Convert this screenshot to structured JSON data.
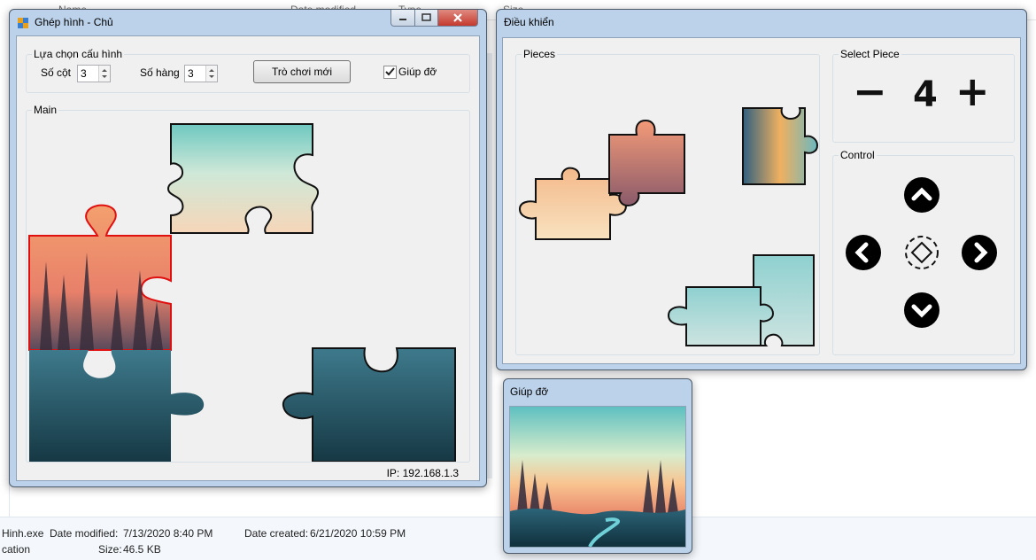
{
  "explorer": {
    "columns": [
      "Name",
      "Date modified",
      "Type",
      "Size"
    ],
    "details": {
      "file_name": "Hinh.exe",
      "date_modified_label": "Date modified:",
      "date_modified": "7/13/2020 8:40 PM",
      "date_created_label": "Date created:",
      "date_created": "6/21/2020 10:59 PM",
      "location_label": "cation",
      "size_label": "Size:",
      "size": "46.5 KB"
    }
  },
  "main_window": {
    "title": "Ghép hình - Chủ",
    "config_group": "Lựa chọn cấu hình",
    "cols_label": "Số cột",
    "cols_value": "3",
    "rows_label": "Số hàng",
    "rows_value": "3",
    "new_game_button": "Trò chơi mới",
    "help_checkbox_label": "Giúp đỡ",
    "help_checked": true,
    "main_group": "Main",
    "ip_text": "IP: 192.168.1.3"
  },
  "control_window": {
    "title": "Điều khiển",
    "pieces_group": "Pieces",
    "select_group": "Select Piece",
    "selected_piece": "4",
    "minus_symbol": "−",
    "plus_symbol": "+",
    "control_group": "Control"
  },
  "help_window": {
    "title": "Giúp đỡ"
  },
  "colors": {
    "title_glass": "#bcd2ea",
    "close_red": "#c9443a",
    "selected_outline": "#e01010",
    "sky_top": "#7fd0c8",
    "sunset": "#f4b07a",
    "forest": "#1f4a5a"
  },
  "icons": [
    "app-icon",
    "minimize-icon",
    "maximize-icon",
    "close-icon",
    "arrow-up-icon",
    "arrow-left-icon",
    "arrow-right-icon",
    "arrow-down-icon",
    "rotate-icon"
  ]
}
